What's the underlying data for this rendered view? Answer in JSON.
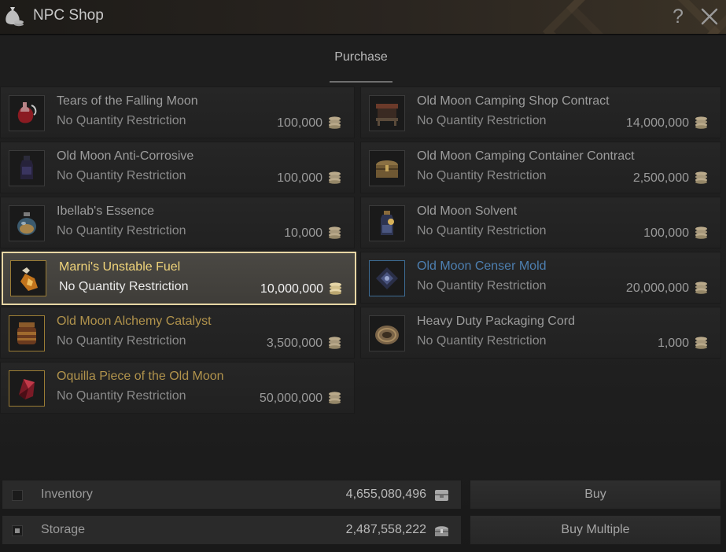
{
  "window": {
    "title": "NPC Shop",
    "icon": "money-bag-icon",
    "help_label": "?",
    "close_icon": "close-icon"
  },
  "tabs": [
    {
      "label": "Purchase",
      "active": true
    }
  ],
  "items": [
    {
      "name": "Tears of the Falling Moon",
      "quantity": "No Quantity Restriction",
      "price": "100,000",
      "icon": "potion-red-icon",
      "name_color": "#9c9c9c"
    },
    {
      "name": "Old Moon Camping Shop Contract",
      "quantity": "No Quantity Restriction",
      "price": "14,000,000",
      "icon": "shop-stall-icon",
      "name_color": "#9c9c9c"
    },
    {
      "name": "Old Moon Anti-Corrosive",
      "quantity": "No Quantity Restriction",
      "price": "100,000",
      "icon": "dark-bottle-icon",
      "name_color": "#9c9c9c"
    },
    {
      "name": "Old Moon Camping Container Contract",
      "quantity": "No Quantity Restriction",
      "price": "2,500,000",
      "icon": "chest-icon",
      "name_color": "#9c9c9c"
    },
    {
      "name": "Ibellab's Essence",
      "quantity": "No Quantity Restriction",
      "price": "10,000",
      "icon": "essence-jar-icon",
      "name_color": "#9c9c9c"
    },
    {
      "name": "Old Moon Solvent",
      "quantity": "No Quantity Restriction",
      "price": "100,000",
      "icon": "solvent-bottle-icon",
      "name_color": "#9c9c9c"
    },
    {
      "name": "Marni's Unstable Fuel",
      "quantity": "No Quantity Restriction",
      "price": "10,000,000",
      "icon": "fuel-flask-icon",
      "name_color": "#f0d47a",
      "selected": true
    },
    {
      "name": "Old Moon Censer Mold",
      "quantity": "No Quantity Restriction",
      "price": "20,000,000",
      "icon": "censer-mold-icon",
      "name_color": "#4d7fb0"
    },
    {
      "name": "Old Moon Alchemy Catalyst",
      "quantity": "No Quantity Restriction",
      "price": "3,500,000",
      "icon": "catalyst-jar-icon",
      "name_color": "#b1934c"
    },
    {
      "name": "Heavy Duty Packaging Cord",
      "quantity": "No Quantity Restriction",
      "price": "1,000",
      "icon": "rope-coil-icon",
      "name_color": "#9c9c9c"
    },
    {
      "name": "Oquilla Piece of the Old Moon",
      "quantity": "No Quantity Restriction",
      "price": "50,000,000",
      "icon": "crystal-shard-icon",
      "name_color": "#b1934c"
    }
  ],
  "currency_icon": "silver-coins-icon",
  "payment": {
    "inventory": {
      "label": "Inventory",
      "amount": "4,655,080,496",
      "checked": false,
      "icon": "inventory-bag-icon"
    },
    "storage": {
      "label": "Storage",
      "amount": "2,487,558,222",
      "checked": true,
      "icon": "storage-chest-icon"
    }
  },
  "buttons": {
    "buy": "Buy",
    "buy_multiple": "Buy Multiple"
  },
  "colors": {
    "selected_border": "#e7d6a4",
    "selected_name": "#f0d47a",
    "gold_name": "#b1934c",
    "blue_name": "#4d7fb0"
  }
}
